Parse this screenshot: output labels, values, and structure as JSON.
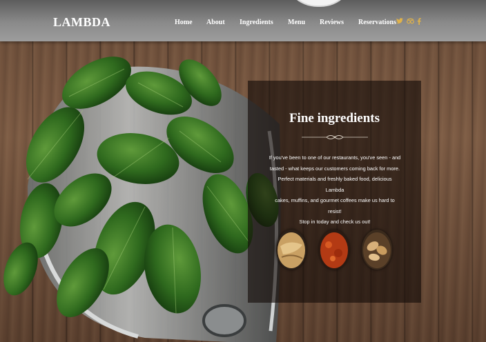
{
  "header": {
    "logo": "LAMBDA",
    "nav": [
      {
        "label": "Home"
      },
      {
        "label": "About"
      },
      {
        "label": "Ingredients"
      },
      {
        "label": "Menu"
      },
      {
        "label": "Reviews"
      },
      {
        "label": "Reservations"
      }
    ],
    "social_icons": [
      "twitter-icon",
      "tripadvisor-icon",
      "facebook-icon"
    ]
  },
  "panel": {
    "title": "Fine ingredients",
    "lines": [
      "If you've been to one of our restaurants, you've seen - and",
      "tasted - what keeps our customers coming back for more.",
      "Perfect materials and freshly baked food, delicious Lambda",
      "cakes, muffins, and gourmet coffees make us hard to resist!",
      "Stop in today and check us out!"
    ],
    "thumbnails": [
      "ginger-image",
      "chili-powder-image",
      "nuts-image"
    ]
  },
  "colors": {
    "accent": "#e0b24a",
    "header": "#8a8a8a",
    "panel": "#140c08"
  }
}
